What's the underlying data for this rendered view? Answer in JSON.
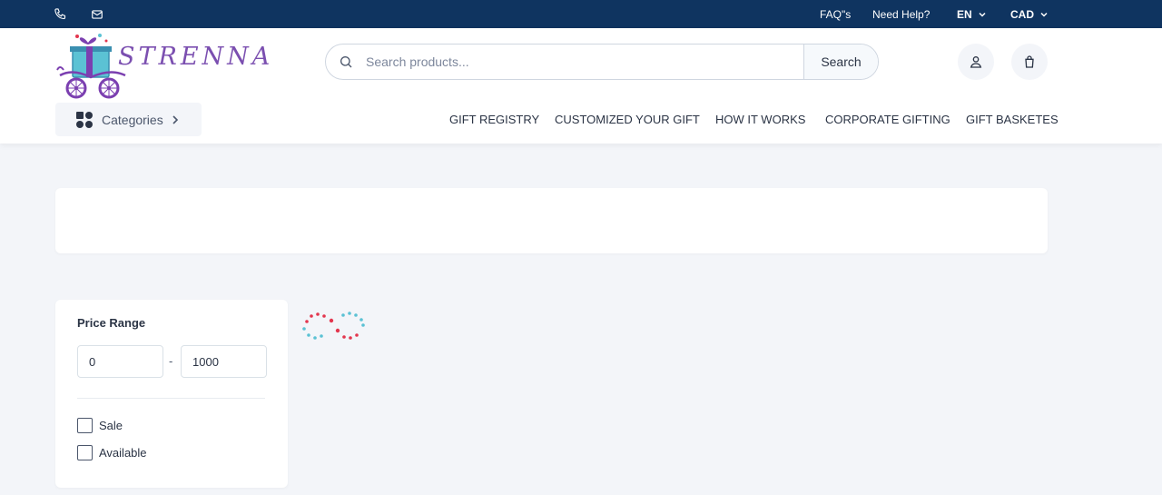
{
  "colors": {
    "topbar": "#0f3460",
    "page_bg": "#f3f5f9",
    "logo_purple": "#7b4fb0",
    "loader_pink": "#e3364e",
    "loader_teal": "#5bc2d4"
  },
  "topbar": {
    "phone_icon": "phone-icon",
    "mail_icon": "mail-icon",
    "faq": "FAQ\"s",
    "help": "Need Help?",
    "language": "EN",
    "currency": "CAD"
  },
  "header": {
    "logo_text": "STRENNA",
    "search": {
      "placeholder": "Search products...",
      "value": "",
      "button": "Search"
    },
    "icons": [
      "search-icon",
      "user-icon",
      "shopping-bag-icon"
    ],
    "categories": "Categories",
    "nav": [
      "GIFT REGISTRY",
      "CUSTOMIZED YOUR GIFT",
      "HOW IT WORKS",
      "CORPORATE GIFTING",
      "GIFT BASKETES"
    ]
  },
  "filter": {
    "title": "Price Range",
    "min": "0",
    "max": "1000",
    "separator": "-",
    "options": [
      "Sale",
      "Available"
    ]
  }
}
